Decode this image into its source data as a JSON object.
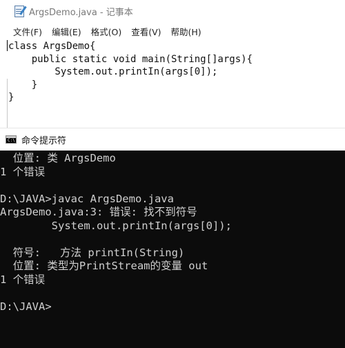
{
  "notepad": {
    "title": "ArgsDemo.java - 记事本",
    "menu": [
      "文件(F)",
      "编辑(E)",
      "格式(O)",
      "查看(V)",
      "帮助(H)"
    ],
    "code_lines": [
      "class ArgsDemo{",
      "    public static void main(String[]args){",
      "        System.out.printIn(args[0]);",
      "    }",
      "}"
    ]
  },
  "cmd": {
    "title": "命令提示符",
    "output_lines": [
      "  位置: 类 ArgsDemo",
      "1 个错误",
      "",
      "D:\\JAVA>javac ArgsDemo.java",
      "ArgsDemo.java:3: 错误: 找不到符号",
      "        System.out.printIn(args[0]);",
      "",
      "  符号:   方法 printIn(String)",
      "  位置: 类型为PrintStream的变量 out",
      "1 个错误",
      "",
      "D:\\JAVA>"
    ]
  }
}
